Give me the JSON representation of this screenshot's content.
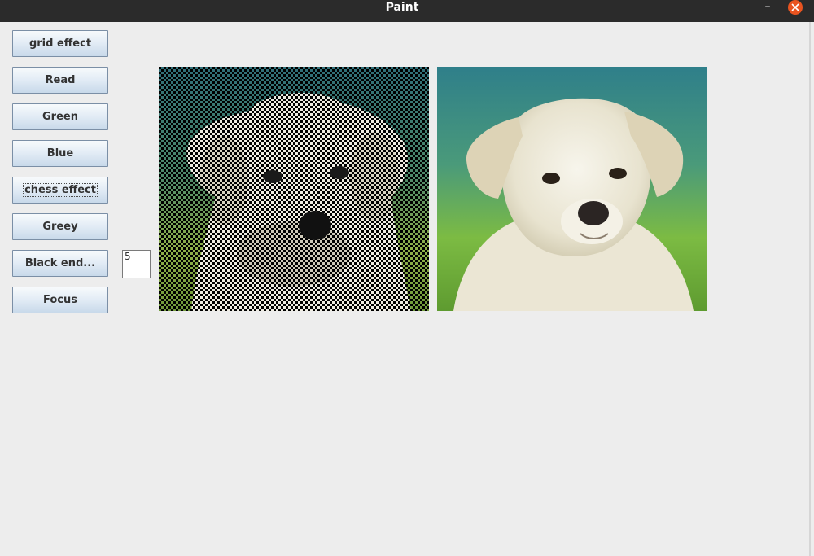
{
  "window": {
    "title": "Paint",
    "minimize_glyph": "–"
  },
  "toolbar": {
    "buttons": [
      {
        "label": "grid effect"
      },
      {
        "label": "Read"
      },
      {
        "label": "Green"
      },
      {
        "label": "Blue"
      },
      {
        "label": "chess effect"
      },
      {
        "label": "Greey"
      },
      {
        "label": "Black end..."
      },
      {
        "label": "Focus"
      }
    ]
  },
  "size_field": {
    "value": "5"
  },
  "images": {
    "left": {
      "icon": "puppy-chess-effect-image"
    },
    "right": {
      "icon": "puppy-original-image"
    }
  },
  "colors": {
    "titlebar": "#2b2b2b",
    "close_button": "#e95420",
    "window_bg": "#ededed",
    "button_gradient_top": "#f7fafc",
    "button_gradient_bottom": "#c8d9ea",
    "button_border": "#7b8fa6"
  }
}
